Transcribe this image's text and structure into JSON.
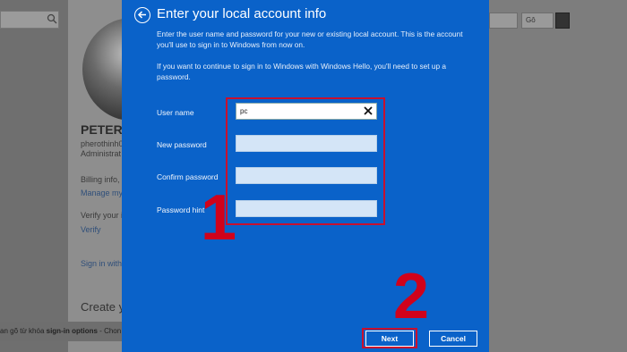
{
  "background": {
    "dropdown_label": "Gô",
    "user_name": "PETER",
    "user_email": "pherothinh0",
    "user_role": "Administrat",
    "billing_text": "Billing info, f",
    "manage_link": "Manage my",
    "verify_text": "Verify your id",
    "verify_link": "Verify",
    "sign_in_link": "Sign in with",
    "create_heading": "Create yo",
    "bottom_hint_prefix": "an gõ từ khóa ",
    "bottom_hint_bold": "sign-in options",
    "bottom_hint_suffix": " - Chon"
  },
  "dialog": {
    "title": "Enter your local account info",
    "description_1": "Enter the user name and password for your new or existing local account. This is the account you'll use to sign in to Windows from now on.",
    "description_2": "If you want to continue to sign in to Windows with Windows Hello, you'll need to set up a password.",
    "fields": [
      {
        "label": "User name",
        "value": "pc"
      },
      {
        "label": "New password",
        "value": ""
      },
      {
        "label": "Confirm password",
        "value": ""
      },
      {
        "label": "Password hint",
        "value": ""
      }
    ],
    "next_label": "Next",
    "cancel_label": "Cancel"
  },
  "annotations": {
    "step_1": "1",
    "step_2": "2"
  },
  "colors": {
    "dialog_blue": "#0a62c9",
    "annotation_red": "#c8102e"
  }
}
